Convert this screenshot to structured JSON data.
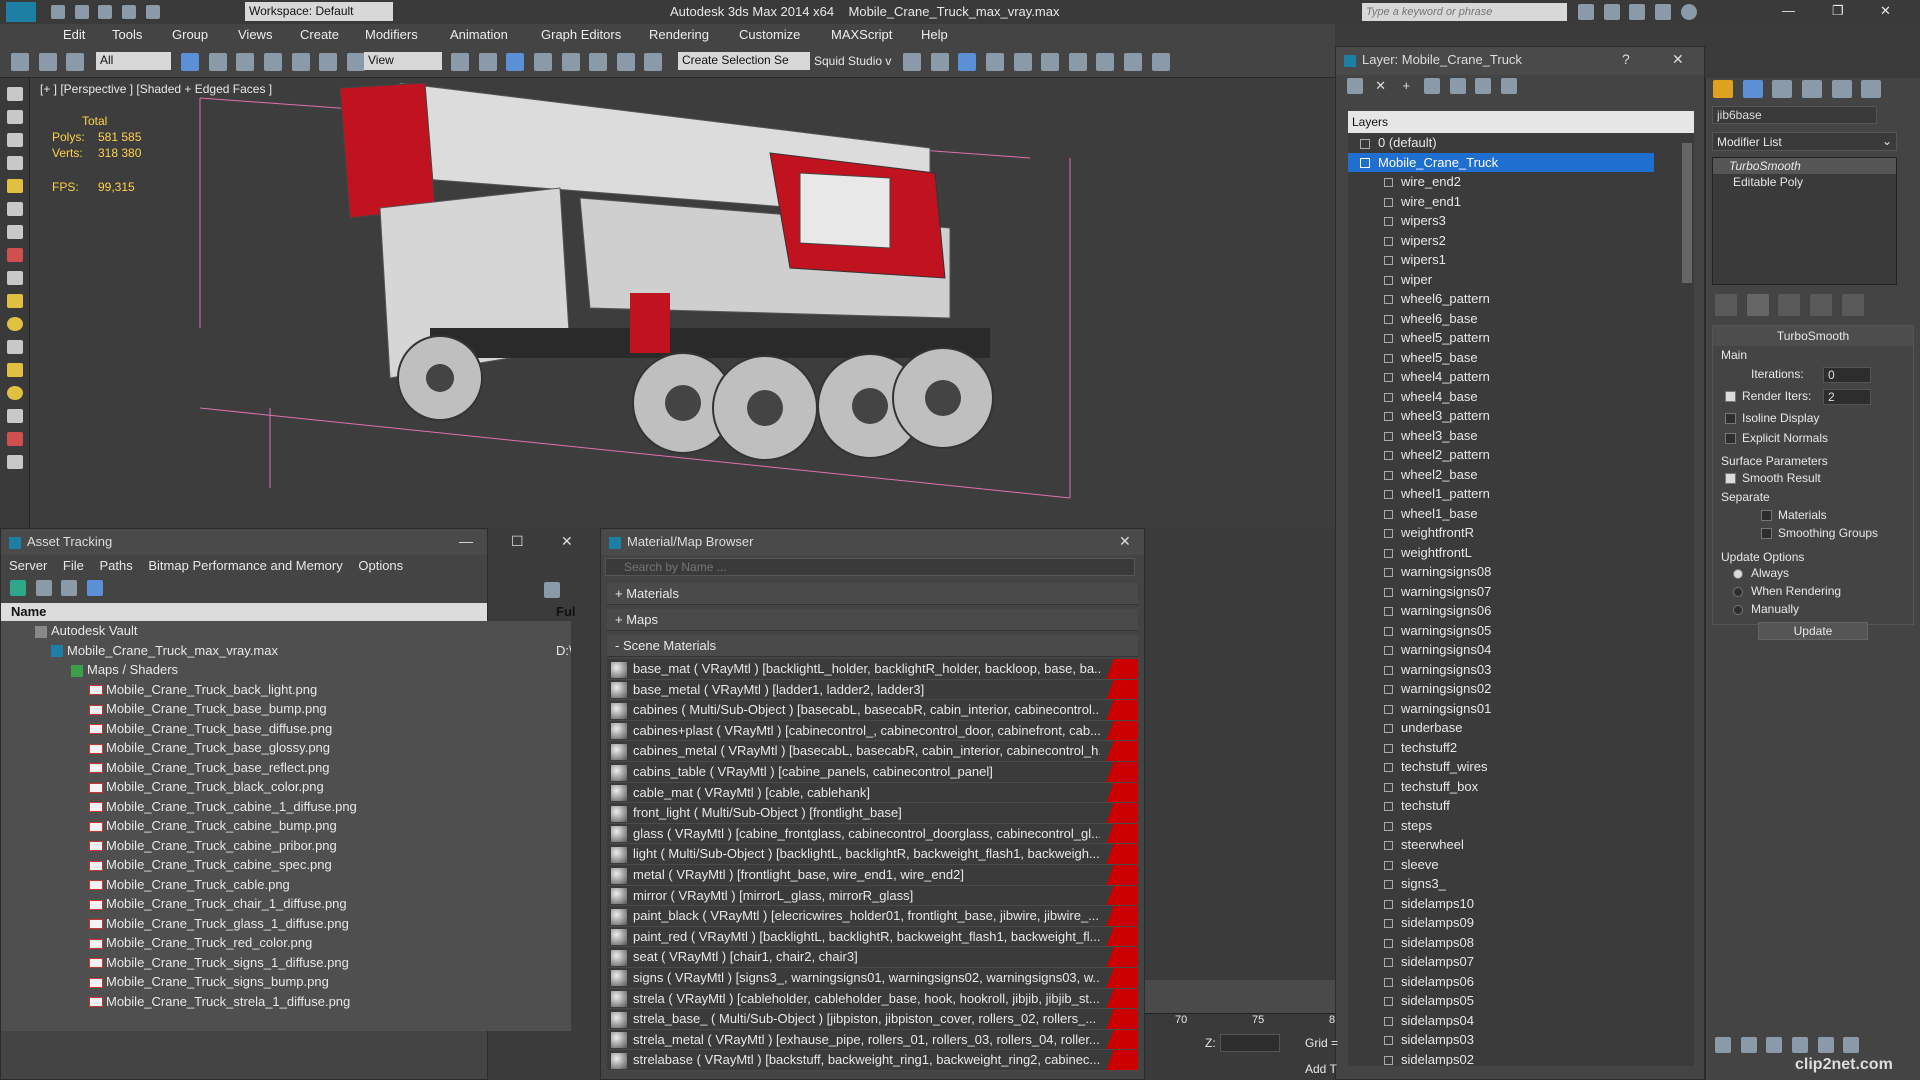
{
  "app": {
    "title": "Autodesk 3ds Max  2014 x64",
    "file": "Mobile_Crane_Truck_max_vray.max",
    "workspace": "Workspace: Default",
    "search_placeholder": "Type a keyword or phrase"
  },
  "menu": [
    "Edit",
    "Tools",
    "Group",
    "Views",
    "Create",
    "Modifiers",
    "Animation",
    "Graph Editors",
    "Rendering",
    "Customize",
    "MAXScript",
    "Help"
  ],
  "toolbar": {
    "filter": "All",
    "view": "View",
    "selection_set": "Create Selection Se",
    "squid": "Squid Studio v"
  },
  "viewport": {
    "label": "[+ ] [Perspective ] [Shaded + Edged Faces ]",
    "total_label": "Total",
    "polys_label": "Polys:",
    "polys": "581 585",
    "verts_label": "Verts:",
    "verts": "318 380",
    "fps_label": "FPS:",
    "fps": "99,315"
  },
  "asset_tracking": {
    "title": "Asset Tracking",
    "menu": [
      "Server",
      "File",
      "Paths",
      "Bitmap Performance and Memory",
      "Options"
    ],
    "col_name": "Name",
    "col_full": "Ful",
    "vault": "Autodesk Vault",
    "maxfile": "Mobile_Crane_Truck_max_vray.max",
    "maxfile_path": "D:\\",
    "maps_group": "Maps / Shaders",
    "files": [
      "Mobile_Crane_Truck_back_light.png",
      "Mobile_Crane_Truck_base_bump.png",
      "Mobile_Crane_Truck_base_diffuse.png",
      "Mobile_Crane_Truck_base_glossy.png",
      "Mobile_Crane_Truck_base_reflect.png",
      "Mobile_Crane_Truck_black_color.png",
      "Mobile_Crane_Truck_cabine_1_diffuse.png",
      "Mobile_Crane_Truck_cabine_bump.png",
      "Mobile_Crane_Truck_cabine_pribor.png",
      "Mobile_Crane_Truck_cabine_spec.png",
      "Mobile_Crane_Truck_cable.png",
      "Mobile_Crane_Truck_chair_1_diffuse.png",
      "Mobile_Crane_Truck_glass_1_diffuse.png",
      "Mobile_Crane_Truck_red_color.png",
      "Mobile_Crane_Truck_signs_1_diffuse.png",
      "Mobile_Crane_Truck_signs_bump.png",
      "Mobile_Crane_Truck_strela_1_diffuse.png"
    ]
  },
  "material_browser": {
    "title": "Material/Map Browser",
    "search_placeholder": "Search by Name ...",
    "materials": "+ Materials",
    "maps": "+ Maps",
    "scene_materials": "- Scene Materials",
    "items": [
      "base_mat ( VRayMtl ) [backlightL_holder, backlightR_holder, backloop, base, ba...",
      "base_metal ( VRayMtl ) [ladder1, ladder2, ladder3]",
      "cabines ( Multi/Sub-Object ) [basecabL, basecabR, cabin_interior, cabinecontrol...",
      "cabines+plast ( VRayMtl ) [cabinecontrol_, cabinecontrol_door, cabinefront, cab...",
      "cabines_metal ( VRayMtl ) [basecabL, basecabR, cabin_interior, cabinecontrol_h...",
      "cabins_table ( VRayMtl ) [cabine_panels, cabinecontrol_panel]",
      "cable_mat ( VRayMtl ) [cable, cablehank]",
      "front_light ( Multi/Sub-Object ) [frontlight_base]",
      "glass ( VRayMtl ) [cabine_frontglass, cabinecontrol_doorglass, cabinecontrol_gl...",
      "light ( Multi/Sub-Object ) [backlightL, backlightR, backweight_flash1, backweigh...",
      "metal ( VRayMtl ) [frontlight_base, wire_end1, wire_end2]",
      "mirror ( VRayMtl ) [mirrorL_glass, mirrorR_glass]",
      "paint_black ( VRayMtl ) [elecricwires_holder01, frontlight_base, jibwire, jibwire_...",
      "paint_red ( VRayMtl ) [backlightL, backlightR, backweight_flash1, backweight_fl...",
      "seat ( VRayMtl ) [chair1, chair2, chair3]",
      "signs ( VRayMtl ) [signs3_, warningsigns01, warningsigns02, warningsigns03, w...",
      "strela ( VRayMtl ) [cableholder, cableholder_base, hook, hookroll, jibjib, jibjib_st...",
      "strela_base_ ( Multi/Sub-Object ) [jibpiston, jibpiston_cover, rollers_02, rollers_...",
      "strela_metal ( VRayMtl ) [exhause_pipe, rollers_01, rollers_03, rollers_04, roller...",
      "strelabase ( VRayMtl ) [backstuff, backweight_ring1, backweight_ring2, cabinec..."
    ]
  },
  "layer_panel": {
    "title": "Layer: Mobile_Crane_Truck",
    "header": "Layers",
    "default_layer": "0 (default)",
    "active_layer": "Mobile_Crane_Truck",
    "items": [
      "wire_end2",
      "wire_end1",
      "wipers3",
      "wipers2",
      "wipers1",
      "wiper",
      "wheel6_pattern",
      "wheel6_base",
      "wheel5_pattern",
      "wheel5_base",
      "wheel4_pattern",
      "wheel4_base",
      "wheel3_pattern",
      "wheel3_base",
      "wheel2_pattern",
      "wheel2_base",
      "wheel1_pattern",
      "wheel1_base",
      "weightfrontR",
      "weightfrontL",
      "warningsigns08",
      "warningsigns07",
      "warningsigns06",
      "warningsigns05",
      "warningsigns04",
      "warningsigns03",
      "warningsigns02",
      "warningsigns01",
      "underbase",
      "techstuff2",
      "techstuff_wires",
      "techstuff_box",
      "techstuff",
      "steps",
      "steerwheel",
      "sleeve",
      "signs3_",
      "sidelamps10",
      "sidelamps09",
      "sidelamps08",
      "sidelamps07",
      "sidelamps06",
      "sidelamps05",
      "sidelamps04",
      "sidelamps03",
      "sidelamps02"
    ]
  },
  "command_panel": {
    "object_name": "jib6base",
    "modifier_list": "Modifier List",
    "stack": [
      "TurboSmooth",
      "Editable Poly"
    ],
    "rollout_title": "TurboSmooth",
    "main_label": "Main",
    "iterations_label": "Iterations:",
    "iterations": "0",
    "render_iters_label": "Render Iters:",
    "render_iters": "2",
    "isoline": "Isoline Display",
    "explicit": "Explicit Normals",
    "surface_params": "Surface Parameters",
    "smooth_result": "Smooth Result",
    "separate": "Separate",
    "materials": "Materials",
    "smoothing_groups": "Smoothing Groups",
    "update_options": "Update Options",
    "always": "Always",
    "when_rendering": "When Rendering",
    "manually": "Manually",
    "update_button": "Update"
  },
  "timeline": {
    "tick70": "70",
    "tick75": "75",
    "tick8": "8",
    "z_label": "Z:",
    "grid_label": "Grid =",
    "add_label": "Add T"
  },
  "watermark": "clip2net.com"
}
